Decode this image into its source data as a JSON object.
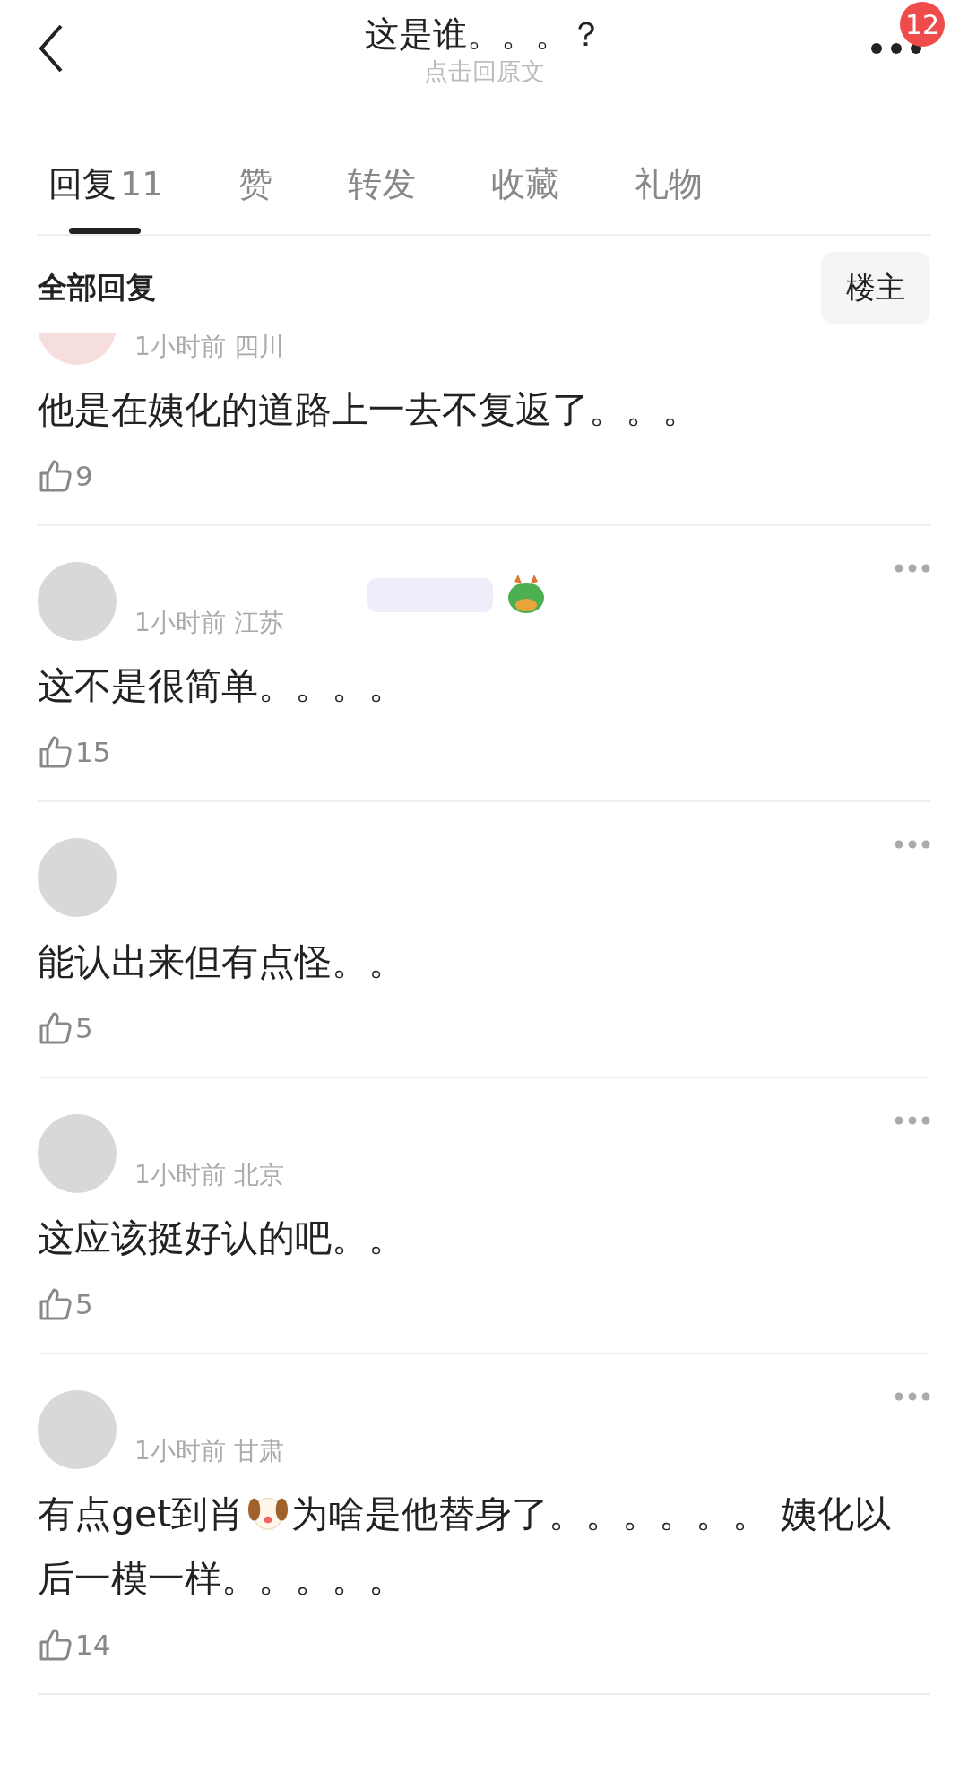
{
  "header": {
    "title": "这是谁。。。？",
    "subtitle": "点击回原文",
    "notification_count": "12"
  },
  "tabs": [
    {
      "label": "回复",
      "count": "11",
      "selected": true
    },
    {
      "label": "赞",
      "selected": false
    },
    {
      "label": "转发",
      "selected": false
    },
    {
      "label": "收藏",
      "selected": false
    },
    {
      "label": "礼物",
      "selected": false
    }
  ],
  "section": {
    "title": "全部回复",
    "filter_button": "楼主"
  },
  "comments": [
    {
      "time": "1小时前",
      "location": "四川",
      "segments": [
        {
          "kind": "text",
          "text": "他是在姨化的道路上一去不复返了。。。"
        }
      ],
      "likes": "9",
      "menu": false,
      "badge": false
    },
    {
      "time": "1小时前",
      "location": "江苏",
      "segments": [
        {
          "kind": "text",
          "text": "这不是很简单。。。。"
        }
      ],
      "likes": "15",
      "menu": true,
      "badge": true
    },
    {
      "segments": [
        {
          "kind": "text",
          "text": "能认出来但有点怪。。"
        }
      ],
      "likes": "5",
      "menu": true,
      "badge": false
    },
    {
      "time": "1小时前",
      "location": "北京",
      "segments": [
        {
          "kind": "text",
          "text": "这应该挺好认的吧。。"
        }
      ],
      "likes": "5",
      "menu": true,
      "badge": false
    },
    {
      "time": "1小时前",
      "location": "甘肃",
      "segments": [
        {
          "kind": "text",
          "text": "有点get到肖"
        },
        {
          "kind": "emoji"
        },
        {
          "kind": "text",
          "text": "为啥是他替身了。。。。。。 姨化以后一模一样。。。。。"
        }
      ],
      "likes": "14",
      "menu": true,
      "badge": false
    }
  ]
}
